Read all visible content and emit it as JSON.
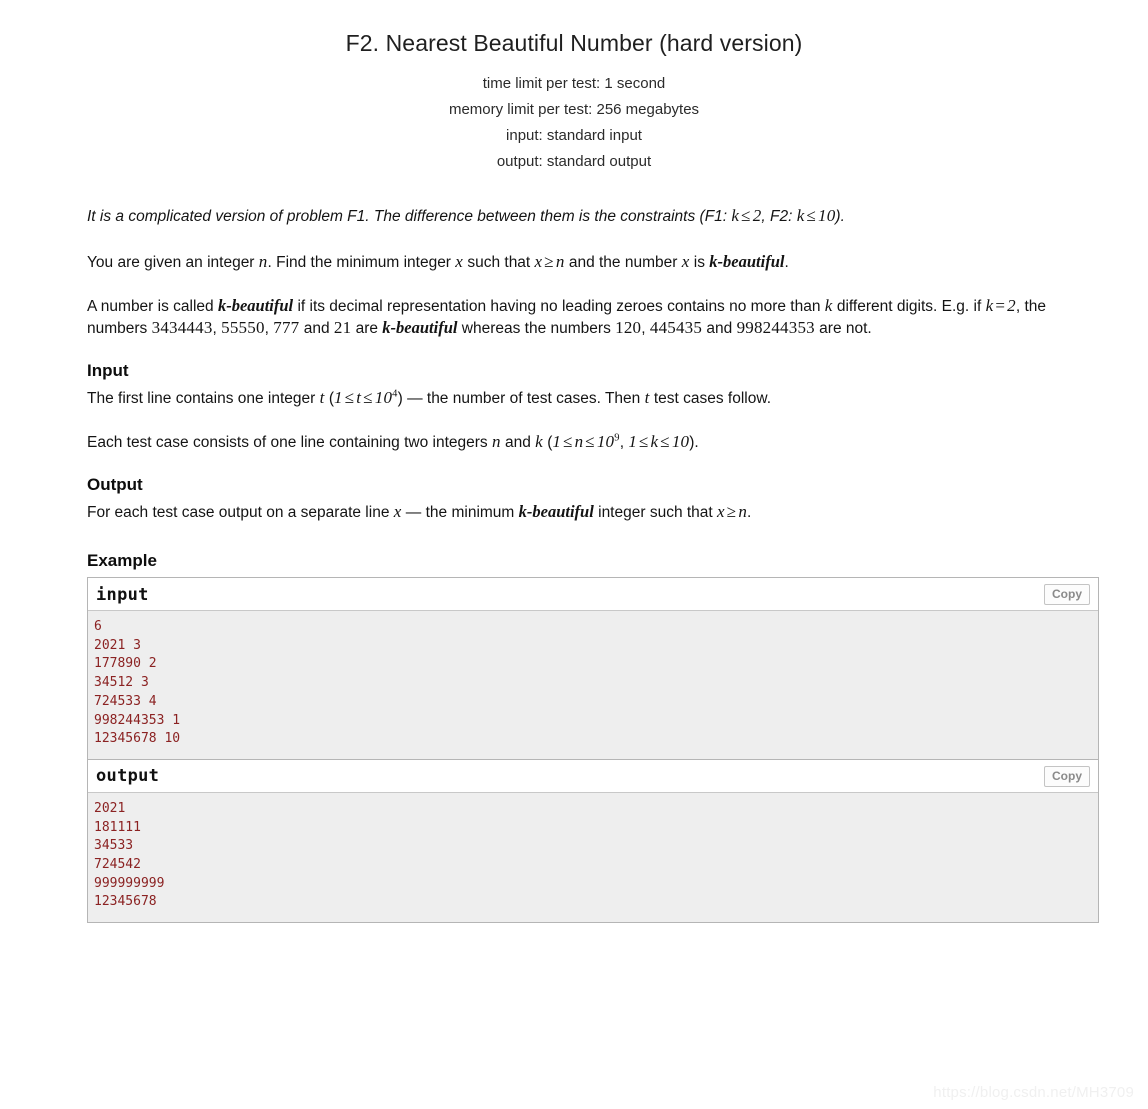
{
  "header": {
    "title": "F2. Nearest Beautiful Number (hard version)",
    "time_limit": "time limit per test: 1 second",
    "memory_limit": "memory limit per test: 256 megabytes",
    "input_mode": "input: standard input",
    "output_mode": "output: standard output"
  },
  "statement": {
    "intro": {
      "part1": "It is a complicated version of problem F1. The difference between them is the constraints (F1: ",
      "math1_var": "k",
      "math1_op": "≤",
      "math1_val": "2",
      "part2": ", F2: ",
      "math2_var": "k",
      "math2_op": "≤",
      "math2_val": "10",
      "part3": ")."
    },
    "p1": {
      "t1": "You are given an integer ",
      "m1": "n",
      "t2": ". Find the minimum integer ",
      "m2": "x",
      "t3": " such that ",
      "m3_a": "x",
      "m3_op": "≥",
      "m3_b": "n",
      "t4": " and the number ",
      "m4": "x",
      "t5": " is ",
      "kb": "k-beautiful",
      "t6": "."
    },
    "p2": {
      "t1": "A number is called ",
      "kb1": "k-beautiful",
      "t2": " if its decimal representation having no leading zeroes contains no more than ",
      "m1": "k",
      "t3": " different digits. E.g. if ",
      "m2_var": "k",
      "m2_op": "=",
      "m2_val": "2",
      "t4": ",",
      "t5": "the numbers ",
      "n1": "3434443",
      "n2": "55550",
      "n3": "777",
      "t6": " and ",
      "n4": "21",
      "t7": " are ",
      "kb2": "k-beautiful",
      "t8": " whereas the numbers ",
      "n5": "120",
      "n6": "445435",
      "t9": " and ",
      "n7": "998244353",
      "t10": " are not."
    }
  },
  "input_section": {
    "heading": "Input",
    "line1": {
      "t1": "The first line contains one integer ",
      "m1": "t",
      "t2": " (",
      "m2_a": "1",
      "m2_op1": "≤",
      "m2_b": "t",
      "m2_op2": "≤",
      "m2_base": "10",
      "m2_exp": "4",
      "t3": ") — the number of test cases. Then ",
      "m3": "t",
      "t4": " test cases follow."
    },
    "line2": {
      "t1": "Each test case consists of one line containing two integers ",
      "m1": "n",
      "t2": " and ",
      "m2": "k",
      "t3": " (",
      "c1_a": "1",
      "c1_op1": "≤",
      "c1_b": "n",
      "c1_op2": "≤",
      "c1_base": "10",
      "c1_exp": "9",
      "t4": ", ",
      "c2_a": "1",
      "c2_op1": "≤",
      "c2_b": "k",
      "c2_op2": "≤",
      "c2_val": "10",
      "t5": ")."
    }
  },
  "output_section": {
    "heading": "Output",
    "line1": {
      "t1": "For each test case output on a separate line ",
      "m1": "x",
      "t2": " — the minimum ",
      "kb": "k-beautiful",
      "t3": " integer such that ",
      "m2_a": "x",
      "m2_op": "≥",
      "m2_b": "n",
      "t4": "."
    }
  },
  "example_section": {
    "heading": "Example",
    "input_box": {
      "label": "input",
      "copy_label": "Copy",
      "content": "6\n2021 3\n177890 2\n34512 3\n724533 4\n998244353 1\n12345678 10"
    },
    "output_box": {
      "label": "output",
      "copy_label": "Copy",
      "content": "2021\n181111\n34533\n724542\n999999999\n12345678"
    }
  },
  "watermark": {
    "text": "https://blog.csdn.net/MH3709"
  },
  "colors": {
    "sample_text": "#8b2222",
    "sample_bg": "#eeeeee",
    "border": "#b5b5b5",
    "copy_text": "#8a8a8a",
    "watermark": "#f0f0f0"
  }
}
